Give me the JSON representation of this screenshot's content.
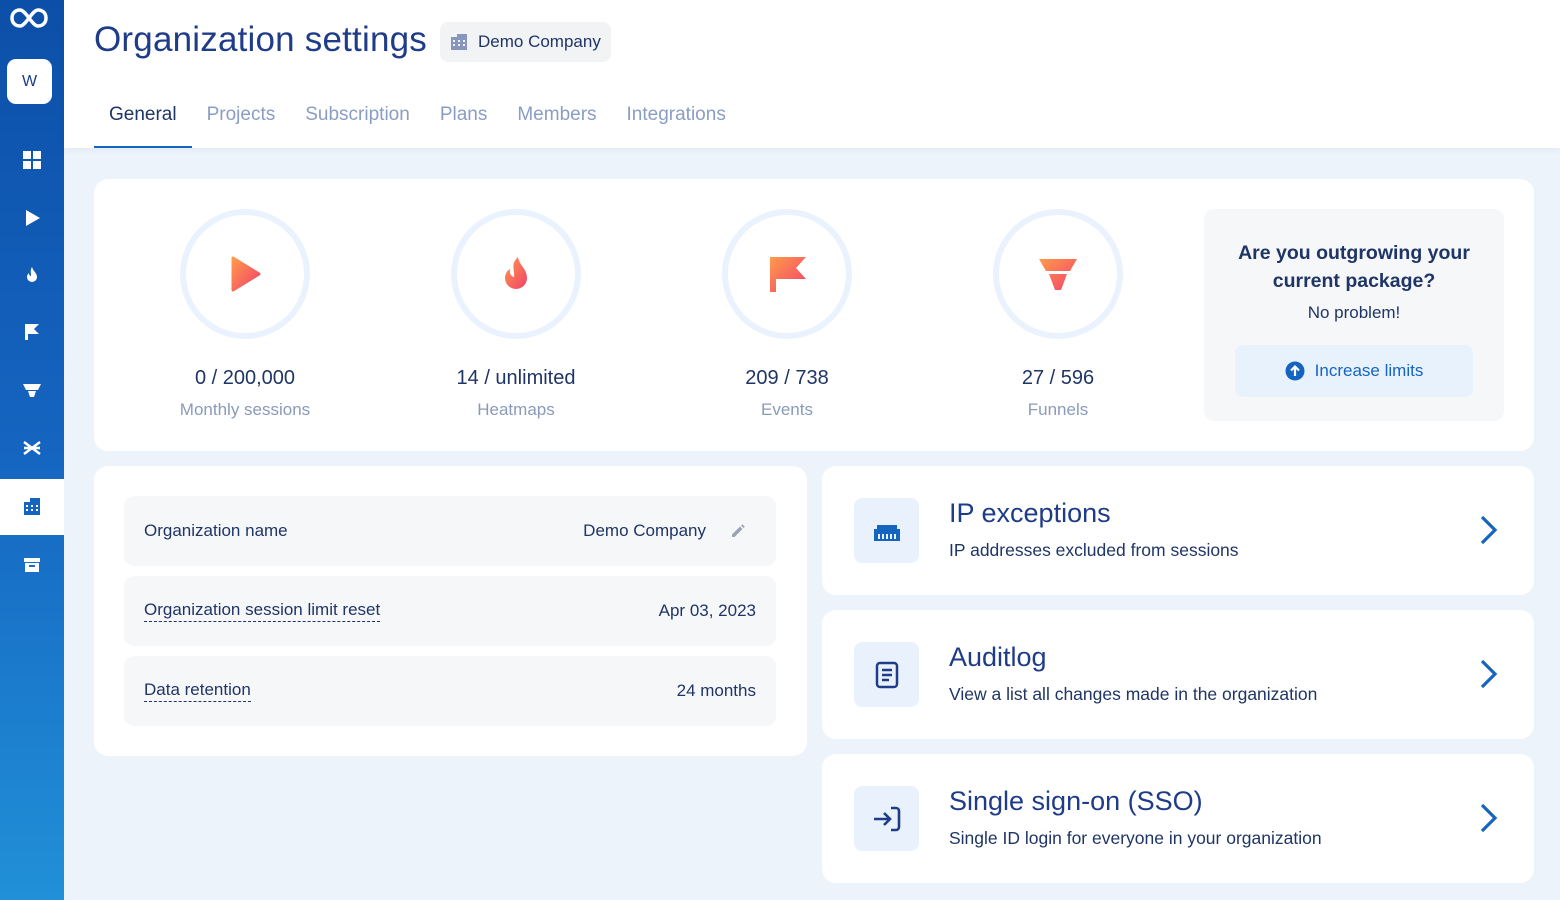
{
  "sidebar": {
    "logo_icon": "infinity-logo-icon",
    "workspace_initial": "W",
    "items": [
      {
        "name": "dashboard-icon"
      },
      {
        "name": "recordings-play-icon"
      },
      {
        "name": "heatmaps-flame-icon"
      },
      {
        "name": "events-flag-icon"
      },
      {
        "name": "funnels-icon"
      },
      {
        "name": "integrations-icon"
      },
      {
        "name": "organization-icon",
        "active": true
      },
      {
        "name": "archive-icon"
      }
    ]
  },
  "header": {
    "title": "Organization settings",
    "org_chip": "Demo Company",
    "tabs": [
      {
        "label": "General",
        "active": true
      },
      {
        "label": "Projects"
      },
      {
        "label": "Subscription"
      },
      {
        "label": "Plans"
      },
      {
        "label": "Members"
      },
      {
        "label": "Integrations"
      }
    ]
  },
  "stats": [
    {
      "value": "0 / 200,000",
      "label": "Monthly sessions",
      "icon": "play-icon"
    },
    {
      "value": "14 / unlimited",
      "label": "Heatmaps",
      "icon": "flame-icon"
    },
    {
      "value": "209 / 738",
      "label": "Events",
      "icon": "flag-icon"
    },
    {
      "value": "27 / 596",
      "label": "Funnels",
      "icon": "funnel-icon"
    }
  ],
  "upsell": {
    "question": "Are you outgrowing your current package?",
    "answer": "No problem!",
    "button": "Increase limits"
  },
  "details": {
    "org_name_label": "Organization name",
    "org_name_value": "Demo Company",
    "reset_label": "Organization session limit reset",
    "reset_value": "Apr 03, 2023",
    "retention_label": "Data retention",
    "retention_value": "24 months"
  },
  "links": [
    {
      "title": "IP exceptions",
      "desc": "IP addresses excluded from sessions",
      "icon": "network-icon"
    },
    {
      "title": "Auditlog",
      "desc": "View a list all changes made in the organization",
      "icon": "document-icon"
    },
    {
      "title": "Single sign-on (SSO)",
      "desc": "Single ID login for everyone in your organization",
      "icon": "login-icon"
    }
  ],
  "colors": {
    "accent": "#1565c0",
    "heading": "#1f3c88",
    "icon_gradient_start": "#ff9a4a",
    "icon_gradient_end": "#f2416b"
  }
}
